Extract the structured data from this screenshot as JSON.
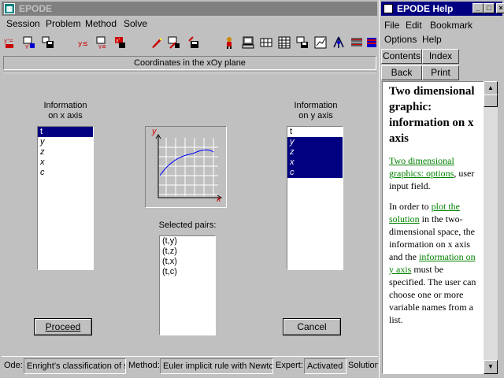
{
  "main": {
    "title": "EPODE",
    "menu": [
      "Session",
      "Problem",
      "Method",
      "Solve"
    ],
    "toolbar_icons": [
      "new-problem-icon",
      "open-problem-icon",
      "save-problem-icon",
      "y-equals-icon",
      "edit-icon",
      "y-prime-icon",
      "pencil-icon",
      "zoom-icon",
      "save-icon",
      "person-icon",
      "computer-icon",
      "grid-icon",
      "table-icon",
      "data-icon",
      "chart-icon",
      "tree-icon",
      "list-icon",
      "flag-icon"
    ],
    "panel_title": "Coordinates in the xOy plane",
    "x_info_label": [
      "Information",
      "on x axis"
    ],
    "y_info_label": [
      "Information",
      "on y axis"
    ],
    "x_list": [
      "t",
      "y",
      "z",
      "x",
      "c"
    ],
    "y_list": [
      "t",
      "y",
      "z",
      "x",
      "c"
    ],
    "graph": {
      "y_label": "y",
      "x_label": "x"
    },
    "selected_label": "Selected pairs:",
    "selected_pairs": [
      "(t,y)",
      "(t,z)",
      "(t,x)",
      "(t,c)"
    ],
    "proceed_label": "Proceed",
    "cancel_label": "Cancel",
    "status": {
      "ode_label": "Ode:",
      "ode_value": "Enright's classification of st",
      "method_label": "Method:",
      "method_value": "Euler implicit rule with Newton",
      "expert_label": "Expert:",
      "expert_value": "Activated",
      "solution_label": "Solution"
    }
  },
  "help": {
    "title": "EPODE Help",
    "menu": [
      "File",
      "Edit",
      "Bookmark",
      "Options",
      "Help"
    ],
    "buttons": [
      "Contents",
      "Index",
      "Back",
      "Print"
    ],
    "heading": "Two dimensional graphic: information on x axis",
    "link1": "Two dimensional graphics: options",
    "after_link1": ", user input field.",
    "p2_start": "In order to ",
    "link2": "plot the solution",
    "p2_mid": " in the two-dimensional space, the information on x axis and the ",
    "link3": "information on y axis",
    "p2_end": " must be specified. The user can choose one or more variable names from a list."
  },
  "colors": {
    "selection": "#000080",
    "link": "#008000",
    "face": "#c0c0c0"
  }
}
